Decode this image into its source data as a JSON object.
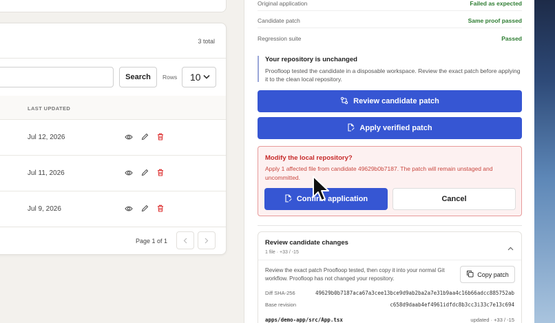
{
  "left": {
    "total_count": "3 total",
    "search_button": "Search",
    "rows_label": "Rows",
    "rows_value": "10",
    "column_last_updated": "LAST UPDATED",
    "rows": [
      {
        "date": "Jul 12, 2026"
      },
      {
        "date": "Jul 11, 2026"
      },
      {
        "date": "Jul 9, 2026"
      }
    ],
    "pager_text": "Page 1 of 1"
  },
  "right": {
    "status": [
      {
        "label": "Original application",
        "value": "Failed as expected"
      },
      {
        "label": "Candidate patch",
        "value": "Same proof passed"
      },
      {
        "label": "Regression suite",
        "value": "Passed"
      }
    ],
    "notice_title": "Your repository is unchanged",
    "notice_body": "Proofloop tested the candidate in a disposable workspace. Review the exact patch before applying it to the clean local repository.",
    "review_patch_button": "Review candidate patch",
    "apply_patch_button": "Apply verified patch",
    "confirm_title": "Modify the local repository?",
    "confirm_body": "Apply 1 affected file from candidate 49629b0b7187. The patch will remain unstaged and uncommitted.",
    "confirm_button": "Confirm application",
    "cancel_button": "Cancel",
    "changes_title": "Review candidate changes",
    "changes_meta": "1 file · +33 / -15",
    "changes_desc": "Review the exact patch Proofloop tested, then copy it into your normal Git workflow. Proofloop has not changed your repository.",
    "copy_patch_button": "Copy patch",
    "diff_sha_label": "Diff SHA-256",
    "diff_sha_value": "49629b0b7187aca67a3cee13bce9d9ab2ba2a7e31b9aa4c16b66adcc885752ab",
    "base_revision_label": "Base revision",
    "base_revision_value": "c658d9daab4ef4961idfdc8b3cc3i33c7e13c694",
    "file_path": "apps/demo-app/src/App.tsx",
    "file_stat": "updated · +33 / -15"
  },
  "colors": {
    "accent": "#3656d3",
    "success": "#2e7d32",
    "danger": "#c62828",
    "danger_bg": "#fdf1f1",
    "danger_border": "#e79a9a"
  }
}
